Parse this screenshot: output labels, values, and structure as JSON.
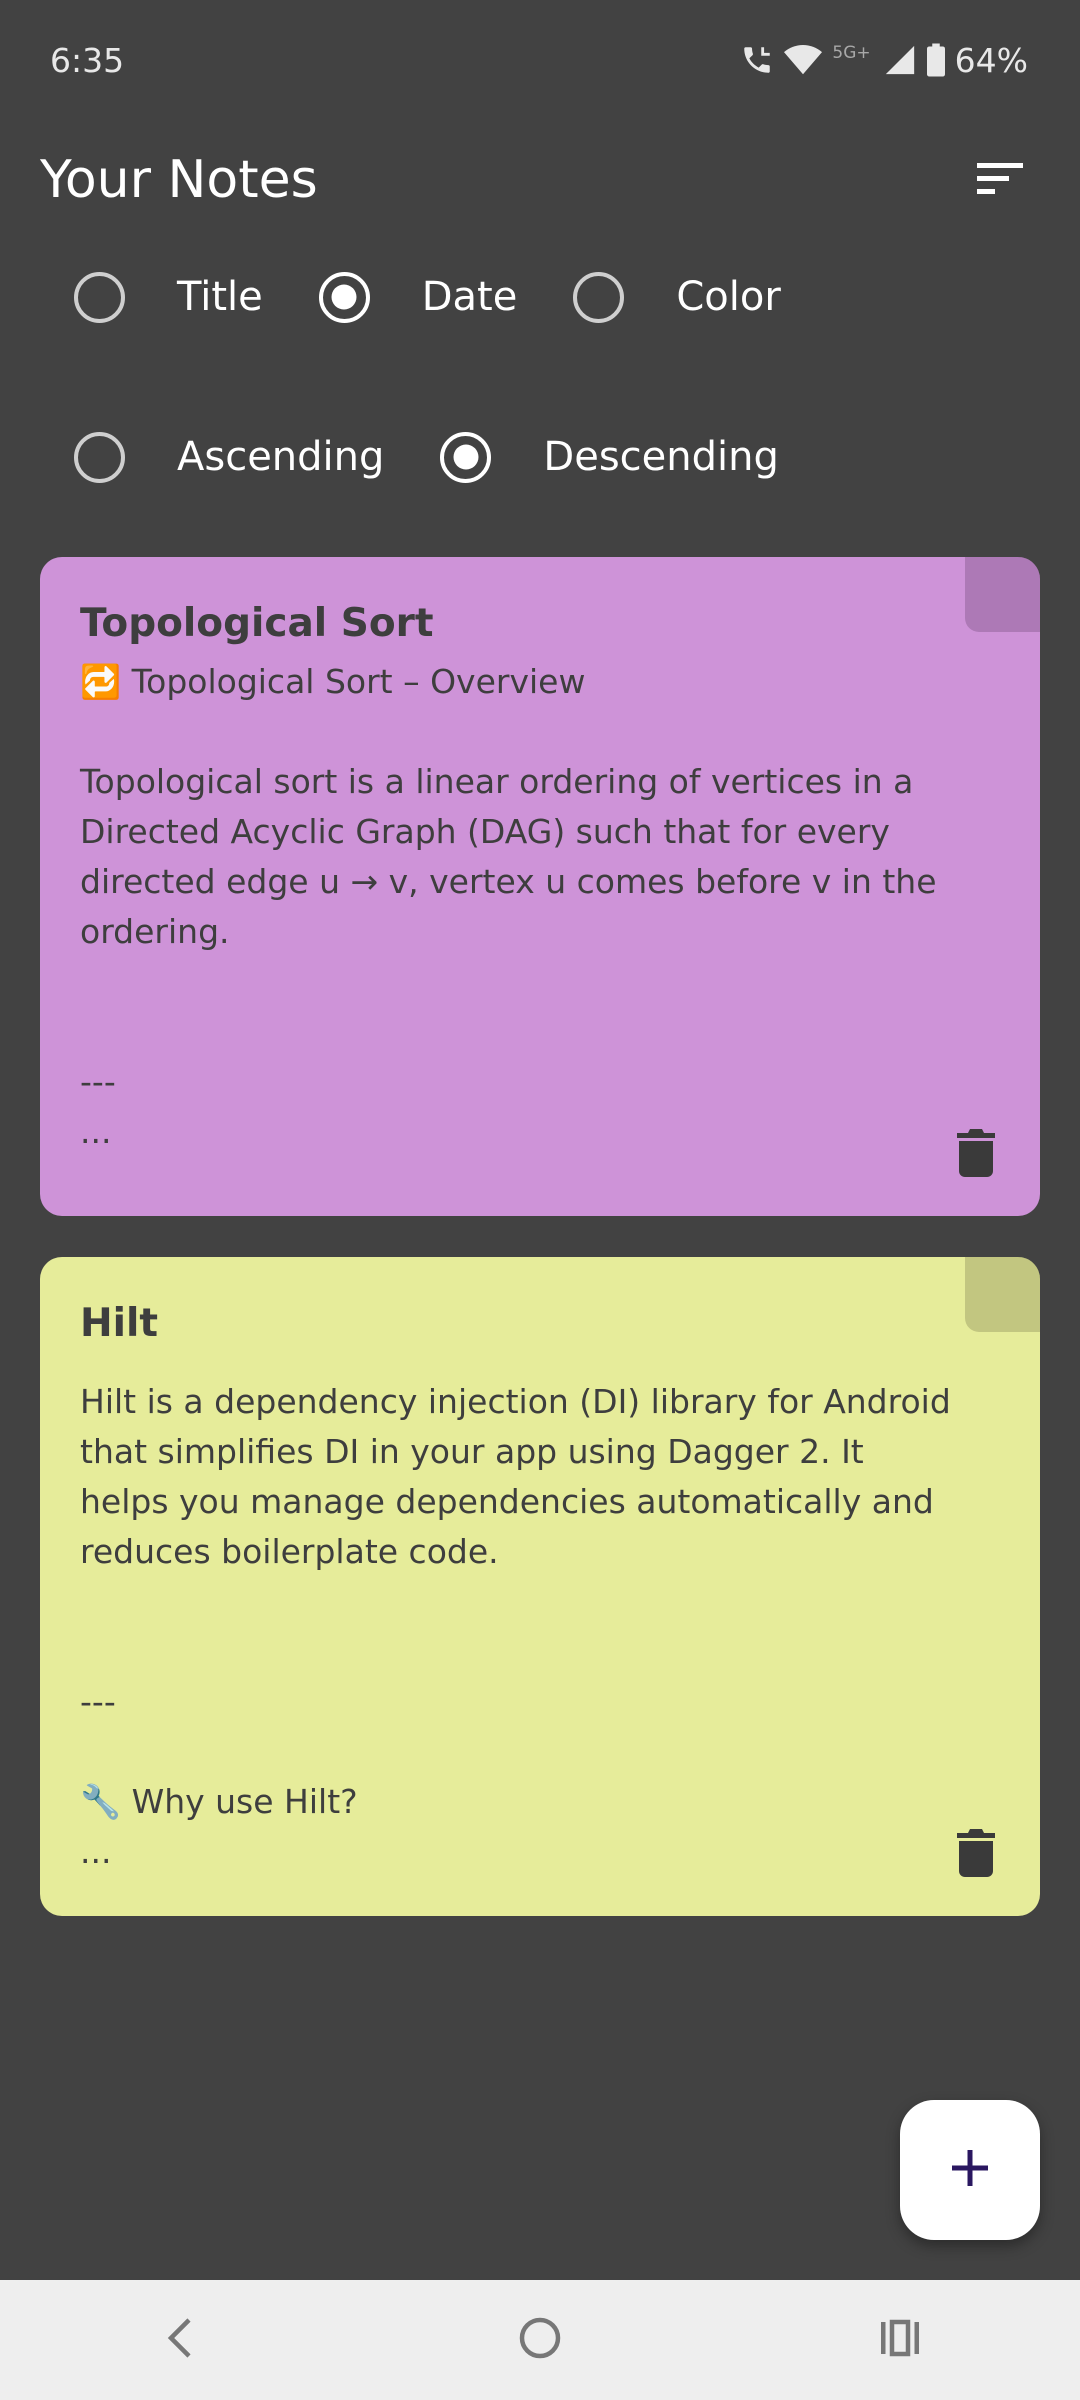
{
  "status_bar": {
    "time": "6:35",
    "network_label": "5G+",
    "battery_percent": "64%"
  },
  "header": {
    "title": "Your Notes",
    "sort_icon": "sort-icon"
  },
  "sort_by": {
    "options": [
      {
        "label": "Title",
        "selected": false
      },
      {
        "label": "Date",
        "selected": true
      },
      {
        "label": "Color",
        "selected": false
      }
    ]
  },
  "sort_order": {
    "options": [
      {
        "label": "Ascending",
        "selected": false
      },
      {
        "label": "Descending",
        "selected": true
      }
    ]
  },
  "notes": [
    {
      "title": "Topological Sort",
      "content": "🔁 Topological Sort – Overview\n\nTopological sort is a linear ordering of vertices in a Directed Acyclic Graph (DAG) such that for every directed edge u → v, vertex u comes before v in the ordering.\n\n\n---\n...",
      "color": "#ce93d8",
      "fold_color": "#ad79b6"
    },
    {
      "title": "Hilt",
      "content": "Hilt is a dependency injection (DI) library for Android that simplifies DI in your app using Dagger 2. It helps you manage dependencies automatically and reduces boilerplate code.\n\n\n---\n\n🔧 Why use Hilt?\n...",
      "color": "#e6ec9a",
      "fold_color": "#c2c680"
    }
  ],
  "fab": {
    "icon": "plus-icon",
    "icon_color": "#2a1760"
  },
  "nav_bar": {
    "back_icon": "back-icon",
    "home_icon": "home-icon",
    "recents_icon": "recents-icon"
  }
}
